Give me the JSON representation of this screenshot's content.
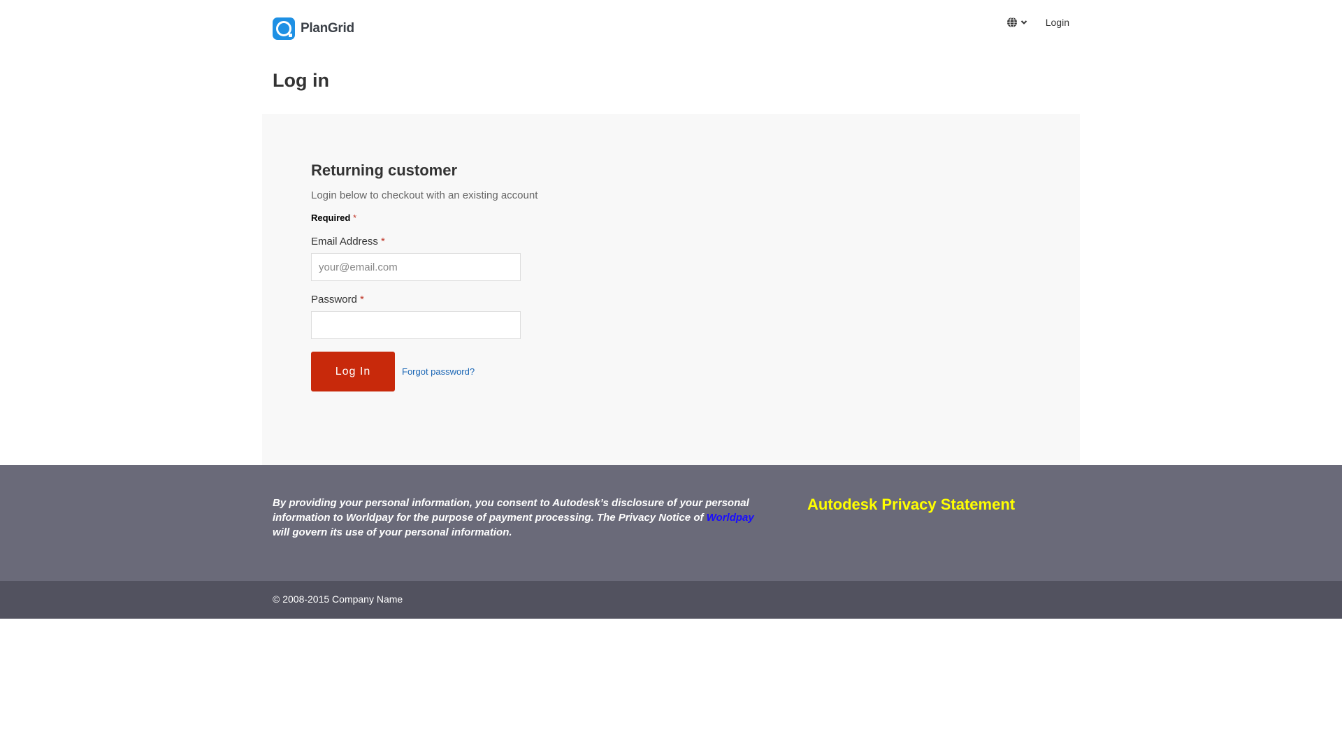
{
  "header": {
    "logo_text": "PlanGrid",
    "nav_login": "Login"
  },
  "page": {
    "title": "Log in"
  },
  "form": {
    "section_title": "Returning customer",
    "subtitle": "Login below to checkout with an existing account",
    "required_label": "Required",
    "asterisk": "*",
    "email_label": "Email Address",
    "email_placeholder": "your@email.com",
    "email_value": "",
    "password_label": "Password",
    "password_value": "",
    "login_button": "Log In",
    "forgot_link": "Forgot password?"
  },
  "footer": {
    "consent_before": "By providing your personal information, you consent to Autodesk’s disclosure of your personal information to Worldpay for the purpose of payment processing. The Privacy Notice of ",
    "consent_link": "Worldpay",
    "consent_after": "  will govern its use of your personal information.",
    "privacy_link": "Autodesk Privacy Statement",
    "copyright": "© 2008-2015 Company Name"
  },
  "colors": {
    "brand_blue": "#1e90e4",
    "button_red": "#c8290b",
    "footer_top": "#6a6a79",
    "footer_bottom": "#52525f",
    "privacy_yellow": "#ffff00"
  },
  "icons": {
    "language": "globe-icon",
    "dropdown": "chevron-down-icon"
  }
}
